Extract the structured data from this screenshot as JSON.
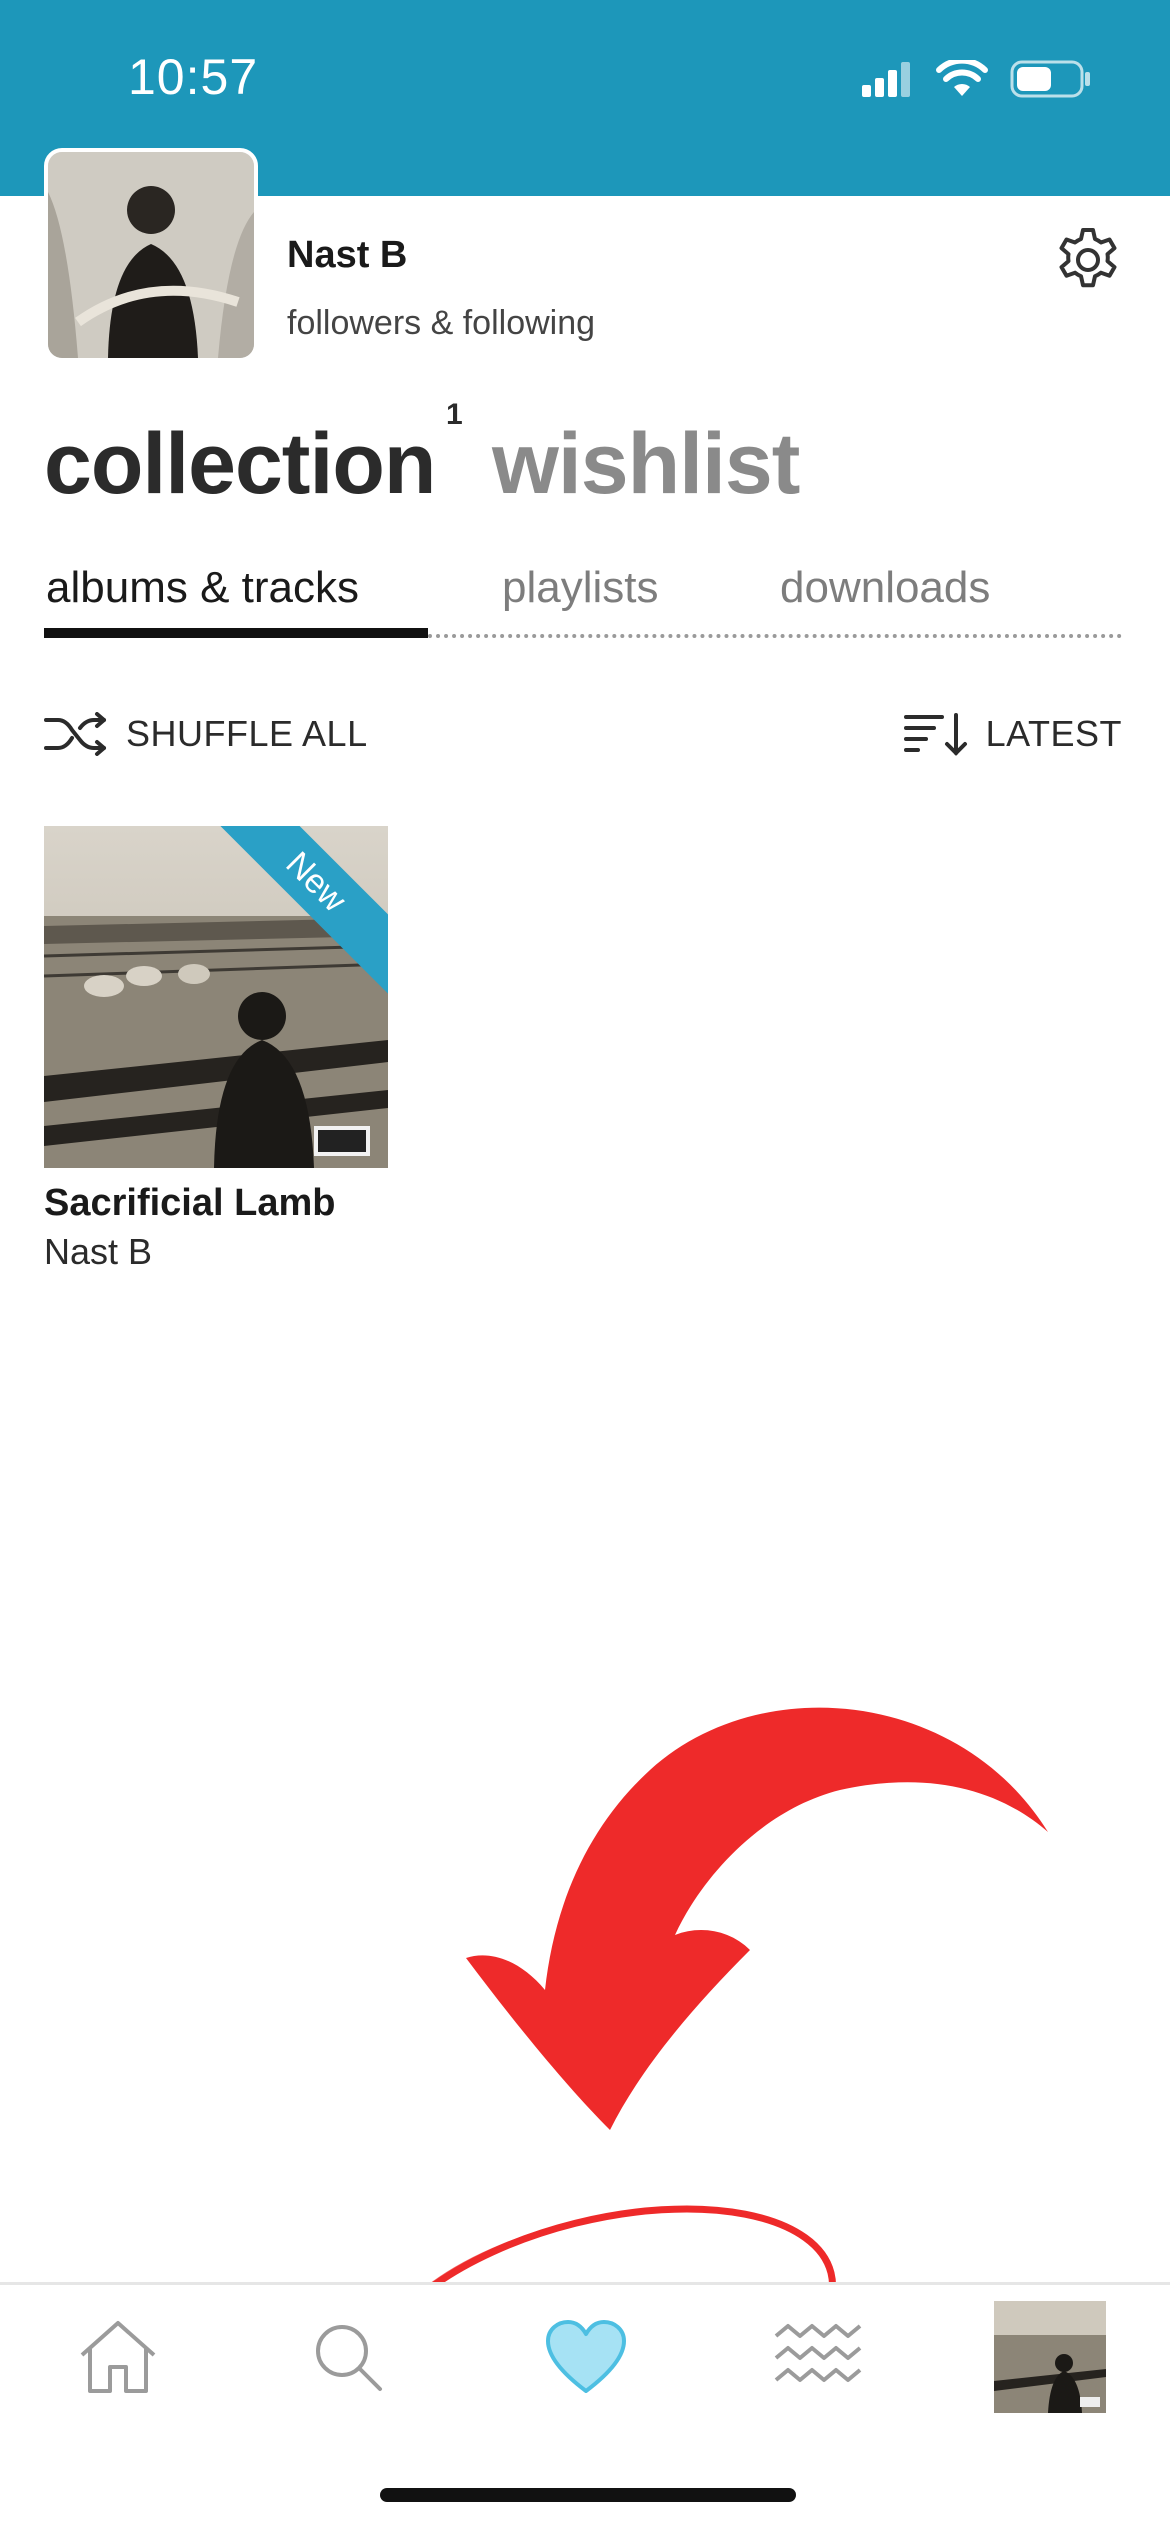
{
  "status_bar": {
    "time": "10:57",
    "background_color": "#1d97ba"
  },
  "profile": {
    "name": "Nast B",
    "subtitle": "followers & following",
    "settings_icon": "gear-icon"
  },
  "big_tabs": {
    "collection": "collection",
    "collection_badge": "1",
    "wishlist": "wishlist",
    "active": "collection"
  },
  "sub_tabs": {
    "items": [
      {
        "label": "albums & tracks",
        "active": true
      },
      {
        "label": "playlists",
        "active": false
      },
      {
        "label": "downloads",
        "active": false
      }
    ]
  },
  "controls": {
    "shuffle_label": "SHUFFLE ALL",
    "shuffle_icon": "shuffle-icon",
    "sort_label": "LATEST",
    "sort_icon": "sort-descending-icon"
  },
  "albums": [
    {
      "title": "Sacrificial Lamb",
      "artist": "Nast B",
      "badge": "New",
      "badge_color": "#2aa0c6"
    }
  ],
  "annotation": {
    "color": "#ee2a2a",
    "shape": "curved arrow pointing to heart tab, circled"
  },
  "bottom_nav": {
    "items": [
      {
        "name": "home",
        "icon": "home-icon",
        "active": false
      },
      {
        "name": "search",
        "icon": "search-icon",
        "active": false
      },
      {
        "name": "collection",
        "icon": "heart-icon",
        "active": true
      },
      {
        "name": "feed",
        "icon": "waves-icon",
        "active": false
      },
      {
        "name": "now-playing",
        "icon": "album-thumbnail",
        "active": false
      }
    ],
    "active_color": "#7fd3ef"
  }
}
